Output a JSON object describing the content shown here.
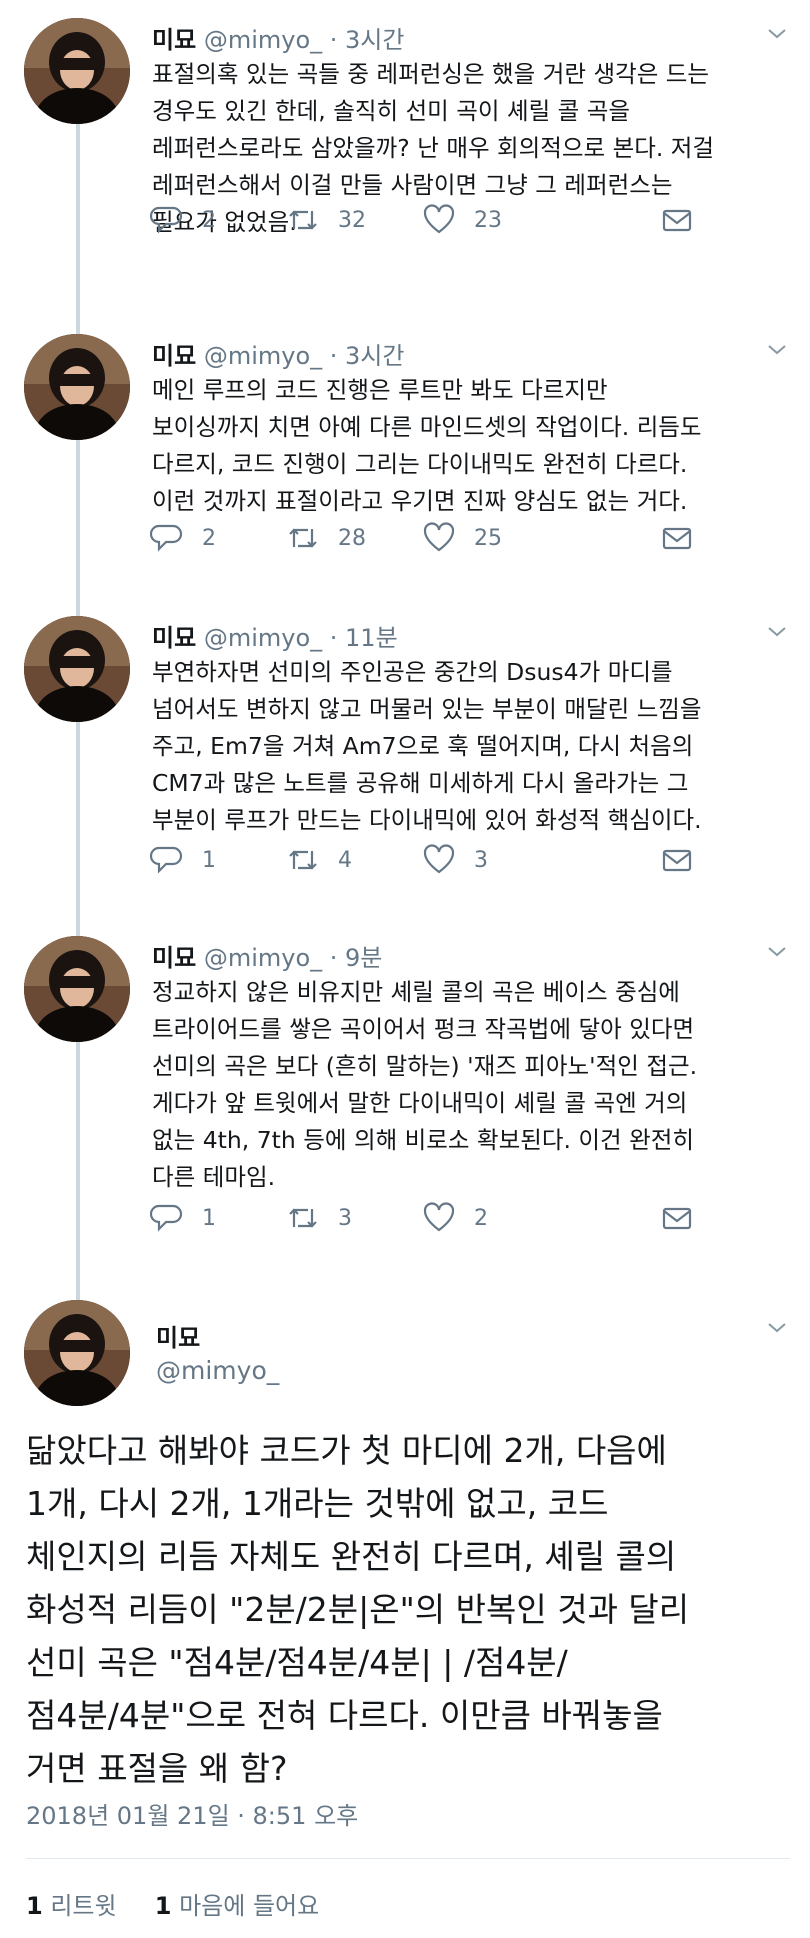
{
  "tweets": [
    {
      "name": "미묘",
      "handle": "@mimyo_",
      "time": "· 3시간",
      "text": "표절의혹 있는 곡들 중 레퍼런싱은 했을 거란 생각은 드는\n경우도 있긴 한데, 솔직히 선미 곡이 셰릴 콜 곡을\n레퍼런스로라도 삼았을까? 난 매우 회의적으로 본다. 저걸\n레퍼런스해서 이걸 만들 사람이면 그냥 그 레퍼런스는\n필요가 없었음.",
      "replies": "2",
      "retweets": "32",
      "likes": "23"
    },
    {
      "name": "미묘",
      "handle": "@mimyo_",
      "time": "· 3시간",
      "text": "메인 루프의 코드 진행은 루트만 봐도 다르지만\n보이싱까지 치면 아예 다른 마인드셋의 작업이다. 리듬도\n다르지, 코드 진행이 그리는 다이내믹도 완전히 다르다.\n이런 것까지 표절이라고 우기면 진짜 양심도 없는 거다.",
      "replies": "2",
      "retweets": "28",
      "likes": "25"
    },
    {
      "name": "미묘",
      "handle": "@mimyo_",
      "time": "· 11분",
      "text": "부연하자면 선미의 주인공은 중간의 Dsus4가 마디를\n넘어서도 변하지 않고 머물러 있는 부분이 매달린 느낌을\n주고, Em7을 거쳐 Am7으로 훅 떨어지며, 다시 처음의\nCM7과 많은 노트를 공유해 미세하게 다시 올라가는 그\n부분이 루프가 만드는 다이내믹에 있어 화성적 핵심이다.",
      "replies": "1",
      "retweets": "4",
      "likes": "3"
    },
    {
      "name": "미묘",
      "handle": "@mimyo_",
      "time": "· 9분",
      "text": "정교하지 않은 비유지만 셰릴 콜의 곡은 베이스 중심에\n트라이어드를 쌓은 곡이어서 펑크 작곡법에 닿아 있다면\n선미의 곡은 보다 (흔히 말하는) '재즈 피아노'적인 접근.\n게다가 앞 트윗에서 말한 다이내믹이 셰릴 콜 곡엔 거의\n없는 4th, 7th 등에 의해 비로소 확보된다. 이건 완전히\n다른 테마임.",
      "replies": "1",
      "retweets": "3",
      "likes": "2"
    }
  ],
  "focus": {
    "name": "미묘",
    "handle": "@mimyo_",
    "text": "닮았다고 해봐야 코드가 첫 마디에 2개, 다음에\n1개, 다시 2개, 1개라는 것밖에 없고, 코드\n체인지의 리듬 자체도 완전히 다르며, 셰릴 콜의\n화성적 리듬이 \"2분/2분|온\"의 반복인 것과 달리\n선미 곡은 \"점4분/점4분/4분|  |   /점4분/\n점4분/4분\"으로 전혀 다르다. 이만큼 바꿔놓을\n거면 표절을 왜 함?",
    "timestamp": "2018년 01월 21일 · 8:51 오후",
    "retweet_count": "1",
    "retweet_label": "리트윗",
    "like_count": "1",
    "like_label": "마음에 들어요"
  },
  "icons": [
    "reply-icon",
    "retweet-icon",
    "like-icon",
    "dm-icon",
    "chevron-down-icon"
  ],
  "colors": {
    "text": "#14171a",
    "muted": "#657786",
    "thread": "#ccd6dd"
  }
}
